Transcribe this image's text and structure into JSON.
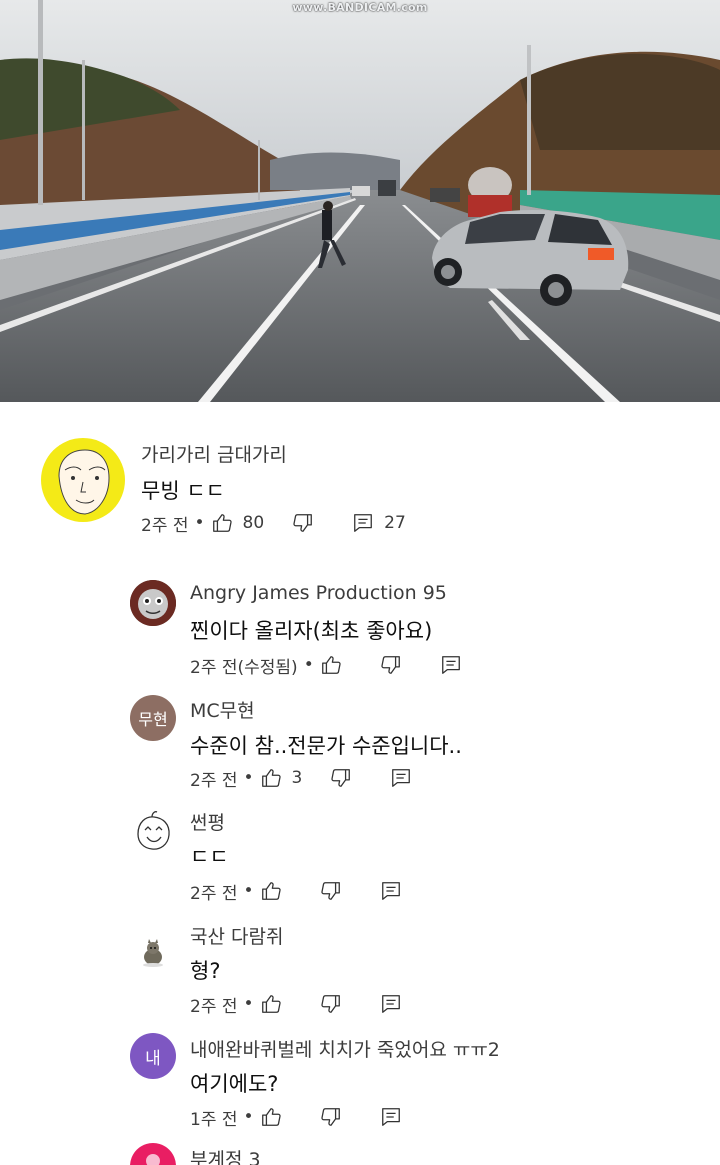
{
  "video": {
    "watermark": "www.BANDICAM.com"
  },
  "comments": [
    {
      "author": "가리가리 금대가리",
      "text": "무빙 ㄷㄷ",
      "time": "2주 전",
      "likes": "80",
      "replies": "27",
      "avatar_bg": "#f4ea17"
    },
    {
      "author": "Angry James Production 95",
      "text": "찐이다 올리자(최초 좋아요)",
      "time": "2주 전(수정됨)",
      "likes": ""
    },
    {
      "author": "MC무현",
      "text": "수준이 참..전문가 수준입니다..",
      "time": "2주 전",
      "likes": "3",
      "avatar_label": "무현",
      "avatar_bg": "#8d6e63"
    },
    {
      "author": "썬평",
      "text": "ㄷㄷ",
      "time": "2주 전",
      "likes": ""
    },
    {
      "author": "국산 다람쥐",
      "text": "형?",
      "time": "2주 전",
      "likes": ""
    },
    {
      "author": "내애완바퀴벌레 치치가 죽었어요 ㅠㅠ2",
      "text": "여기에도?",
      "time": "1주 전",
      "likes": "",
      "avatar_label": "내",
      "avatar_bg": "#7e57c2"
    },
    {
      "author": "부계정 3",
      "avatar_bg": "#e91e63"
    }
  ],
  "meta_separator": "•",
  "icons": {
    "like": "thumb-up-icon",
    "dislike": "thumb-down-icon",
    "reply": "reply-comment-icon"
  }
}
